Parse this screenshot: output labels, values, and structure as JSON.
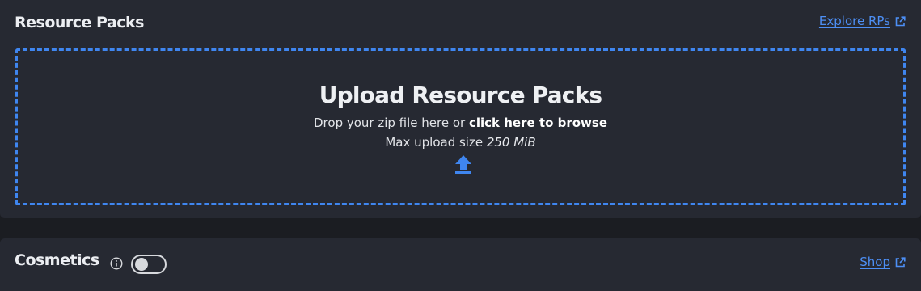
{
  "resource_packs": {
    "title": "Resource Packs",
    "explore_link": "Explore RPs",
    "upload": {
      "title": "Upload Resource Packs",
      "drop_text": "Drop your zip file here or ",
      "browse_text": "click here to browse",
      "max_label": "Max upload size ",
      "max_value": "250 MiB"
    }
  },
  "cosmetics": {
    "title": "Cosmetics",
    "toggle_on": false,
    "shop_link": "Shop"
  },
  "colors": {
    "accent": "#3f86f0",
    "link": "#4d8ff5",
    "panel": "#262932",
    "background": "#1b1d22"
  }
}
